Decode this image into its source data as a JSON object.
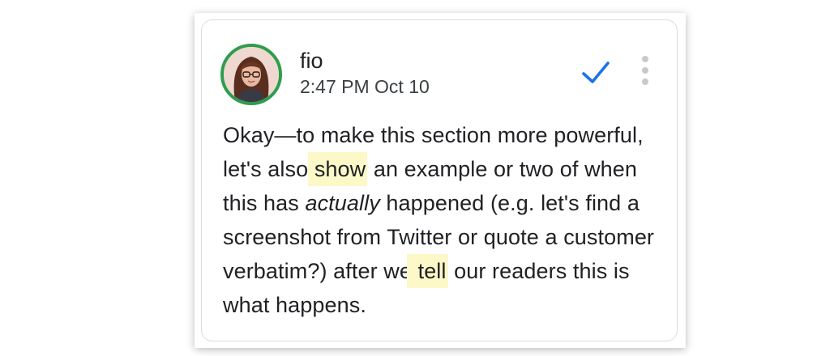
{
  "comment": {
    "author": "fio",
    "timestamp": "2:47 PM Oct 10",
    "resolve_icon": "checkmark-icon",
    "more_icon": "more-vert-icon",
    "accent_color": "#1a73e8",
    "avatar_ring_color": "#2e9d4e",
    "highlight_color": "#fcf8c8",
    "body": {
      "p1": "Okay—to make this section more powerful, let's also ",
      "hl1": "show",
      "p2": " an example or two of when this has ",
      "em": "actually",
      "p3": " happened (e.g. let's find a screenshot from Twitter or quote a customer verbatim?) after we ",
      "hl2": "tell",
      "p4": " our readers this is what happens."
    }
  }
}
